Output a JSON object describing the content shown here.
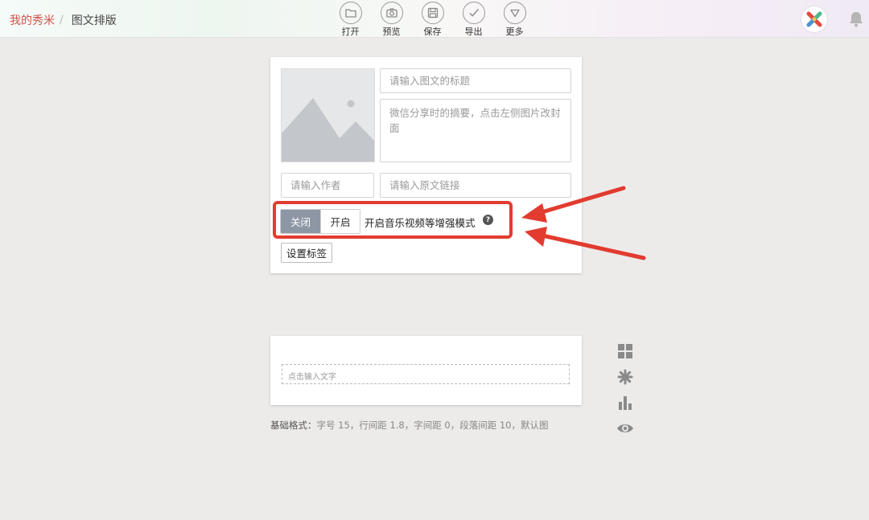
{
  "breadcrumb": {
    "home": "我的秀米",
    "separator": "/",
    "current": "图文排版"
  },
  "toolbar": [
    {
      "label": "打开",
      "icon": "folder-icon"
    },
    {
      "label": "预览",
      "icon": "camera-icon"
    },
    {
      "label": "保存",
      "icon": "save-icon"
    },
    {
      "label": "导出",
      "icon": "check-icon"
    },
    {
      "label": "更多",
      "icon": "triangle-down-icon"
    }
  ],
  "colors": {
    "accent_red": "#d0534a",
    "highlight": "#e23b2f",
    "toggle_active": "#8c96a4"
  },
  "cover_form": {
    "title_placeholder": "请输入图文的标题",
    "digest_placeholder": "微信分享时的摘要，点击左侧图片改封面",
    "author_placeholder": "请输入作者",
    "link_placeholder": "请输入原文链接",
    "toggle_off": "关闭",
    "toggle_on": "开启",
    "toggle_state": "off",
    "mode_label": "开启音乐视频等增强模式",
    "help_icon": "?",
    "tag_button": "设置标签"
  },
  "editor": {
    "placeholder": "点击输入文字"
  },
  "format": {
    "key": "基础格式：",
    "value": "字号 15，行间距 1.8，字间距 0，段落间距 10，默认图"
  },
  "side_tools": [
    "grid-icon",
    "gear-icon",
    "bar-chart-icon",
    "eye-icon"
  ]
}
